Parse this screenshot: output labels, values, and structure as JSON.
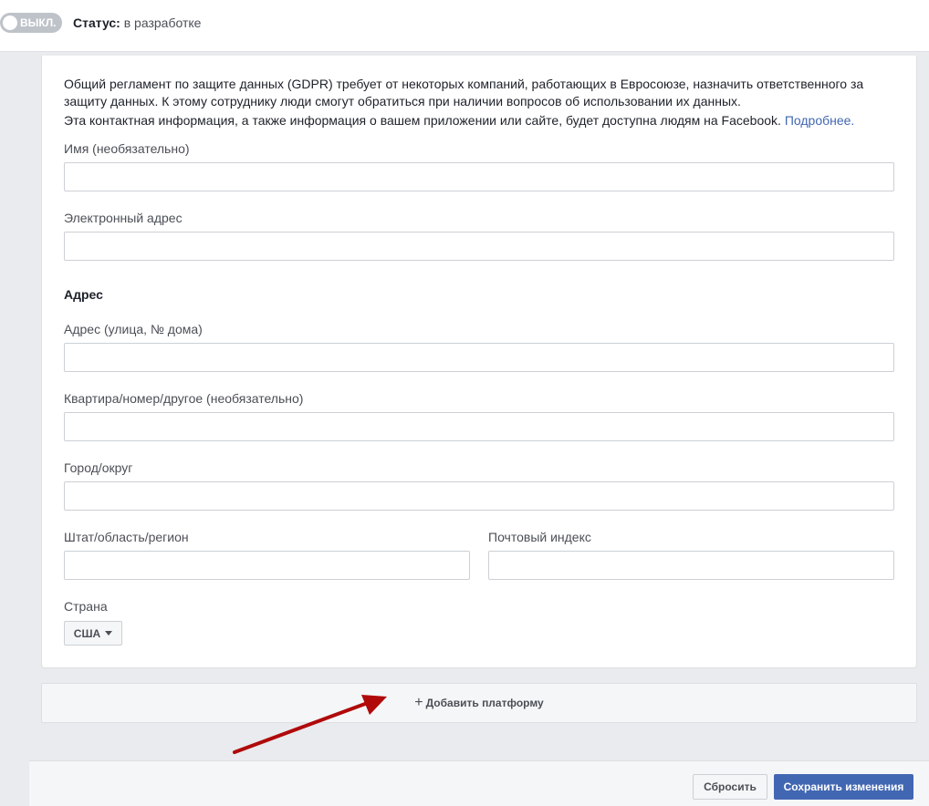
{
  "header": {
    "toggle_label": "ВЫКЛ.",
    "status_label": "Статус:",
    "status_value": "в разработке"
  },
  "form": {
    "intro_line1": "Общий регламент по защите данных (GDPR) требует от некоторых компаний, работающих в Евросоюзе, назначить ответственного за защиту данных. К этому сотруднику люди смогут обратиться при наличии вопросов об использовании их данных.",
    "intro_line2": "Эта контактная информация, а также информация о вашем приложении или сайте, будет доступна людям на Facebook.",
    "learn_more": "Подробнее.",
    "name_label": "Имя (необязательно)",
    "email_label": "Электронный адрес",
    "address_section": "Адрес",
    "street_label": "Адрес (улица, № дома)",
    "apartment_label": "Квартира/номер/другое (необязательно)",
    "city_label": "Город/округ",
    "state_label": "Штат/область/регион",
    "zip_label": "Почтовый индекс",
    "country_label": "Страна",
    "country_value": "США",
    "fields": {
      "name": "",
      "email": "",
      "street": "",
      "apartment": "",
      "city": "",
      "state": "",
      "zip": ""
    }
  },
  "add_platform": {
    "icon": "plus-icon",
    "label": "Добавить платформу"
  },
  "footer": {
    "reset_label": "Сбросить",
    "save_label": "Сохранить изменения"
  },
  "colors": {
    "accent": "#4267b2",
    "annotation_arrow": "#b00a0a"
  }
}
